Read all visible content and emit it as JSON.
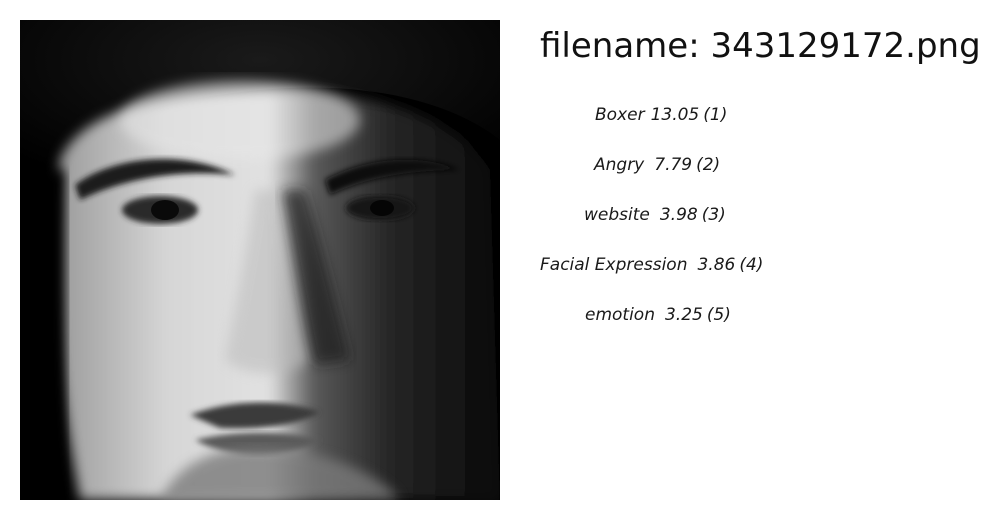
{
  "header": {
    "filename_text": "filename: 343129172.png"
  },
  "image": {
    "subject": "black-and-white close-up portrait of a man"
  },
  "predictions": [
    {
      "label": "Boxer",
      "score": "13.05",
      "rank": "(1)"
    },
    {
      "label": "Angry",
      "score": "7.79",
      "rank": "(2)"
    },
    {
      "label": "website",
      "score": "3.98",
      "rank": "(3)"
    },
    {
      "label": "Facial Expression",
      "score": "3.86",
      "rank": "(4)"
    },
    {
      "label": "emotion",
      "score": "3.25",
      "rank": "(5)"
    }
  ]
}
